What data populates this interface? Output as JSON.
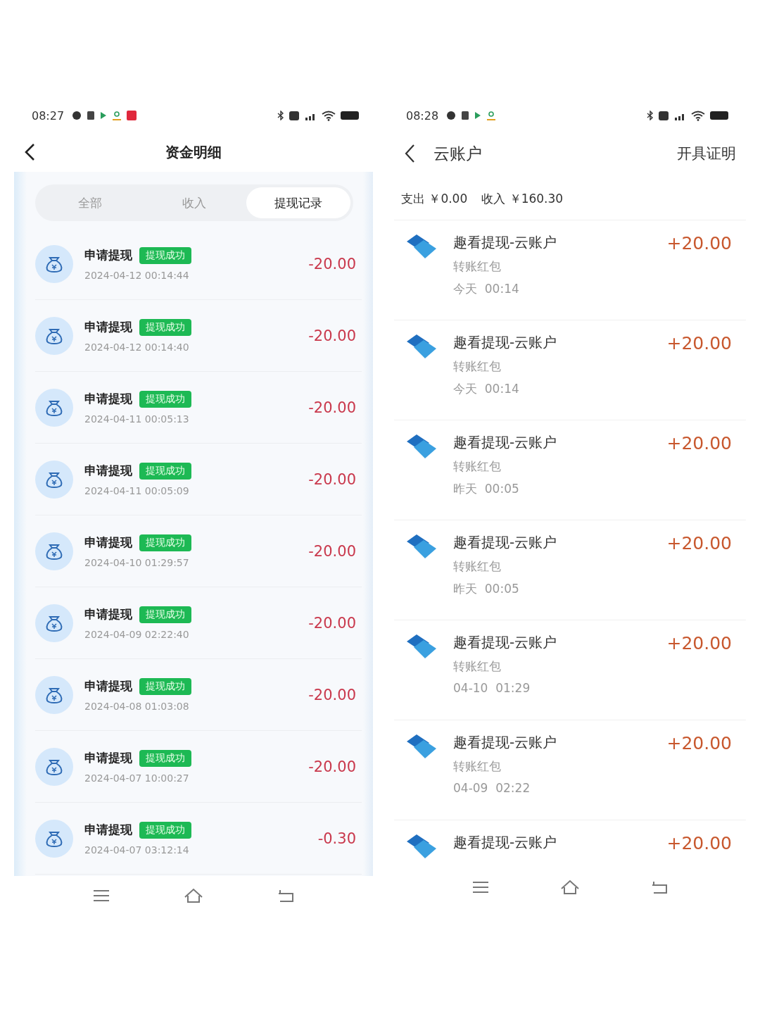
{
  "left_screen": {
    "status_bar": {
      "time": "08:27"
    },
    "header": {
      "title": "资金明细"
    },
    "tabs": [
      {
        "label": "全部",
        "selected": false
      },
      {
        "label": "收入",
        "selected": false
      },
      {
        "label": "提现记录",
        "selected": true
      }
    ],
    "rows": [
      {
        "title": "申请提现",
        "badge": "提现成功",
        "datetime": "2024-04-12 00:14:44",
        "amount": "-20.00"
      },
      {
        "title": "申请提现",
        "badge": "提现成功",
        "datetime": "2024-04-12 00:14:40",
        "amount": "-20.00"
      },
      {
        "title": "申请提现",
        "badge": "提现成功",
        "datetime": "2024-04-11 00:05:13",
        "amount": "-20.00"
      },
      {
        "title": "申请提现",
        "badge": "提现成功",
        "datetime": "2024-04-11 00:05:09",
        "amount": "-20.00"
      },
      {
        "title": "申请提现",
        "badge": "提现成功",
        "datetime": "2024-04-10 01:29:57",
        "amount": "-20.00"
      },
      {
        "title": "申请提现",
        "badge": "提现成功",
        "datetime": "2024-04-09 02:22:40",
        "amount": "-20.00"
      },
      {
        "title": "申请提现",
        "badge": "提现成功",
        "datetime": "2024-04-08 01:03:08",
        "amount": "-20.00"
      },
      {
        "title": "申请提现",
        "badge": "提现成功",
        "datetime": "2024-04-07 10:00:27",
        "amount": "-20.00"
      },
      {
        "title": "申请提现",
        "badge": "提现成功",
        "datetime": "2024-04-07 03:12:14",
        "amount": "-0.30"
      }
    ]
  },
  "right_screen": {
    "status_bar": {
      "time": "08:28"
    },
    "header": {
      "title": "云账户",
      "action": "开具证明"
    },
    "summary": [
      "支出 ￥0.00",
      "收入 ￥160.30"
    ],
    "rows": [
      {
        "title": "趣看提现-云账户",
        "subtitle": "转账红包",
        "time": "今天  00:14",
        "amount": "+20.00"
      },
      {
        "title": "趣看提现-云账户",
        "subtitle": "转账红包",
        "time": "今天  00:14",
        "amount": "+20.00"
      },
      {
        "title": "趣看提现-云账户",
        "subtitle": "转账红包",
        "time": "昨天  00:05",
        "amount": "+20.00"
      },
      {
        "title": "趣看提现-云账户",
        "subtitle": "转账红包",
        "time": "昨天  00:05",
        "amount": "+20.00"
      },
      {
        "title": "趣看提现-云账户",
        "subtitle": "转账红包",
        "time": "04-10  01:29",
        "amount": "+20.00"
      },
      {
        "title": "趣看提现-云账户",
        "subtitle": "转账红包",
        "time": "04-09  02:22",
        "amount": "+20.00"
      },
      {
        "title": "趣看提现-云账户",
        "amount": "+20.00"
      }
    ]
  }
}
